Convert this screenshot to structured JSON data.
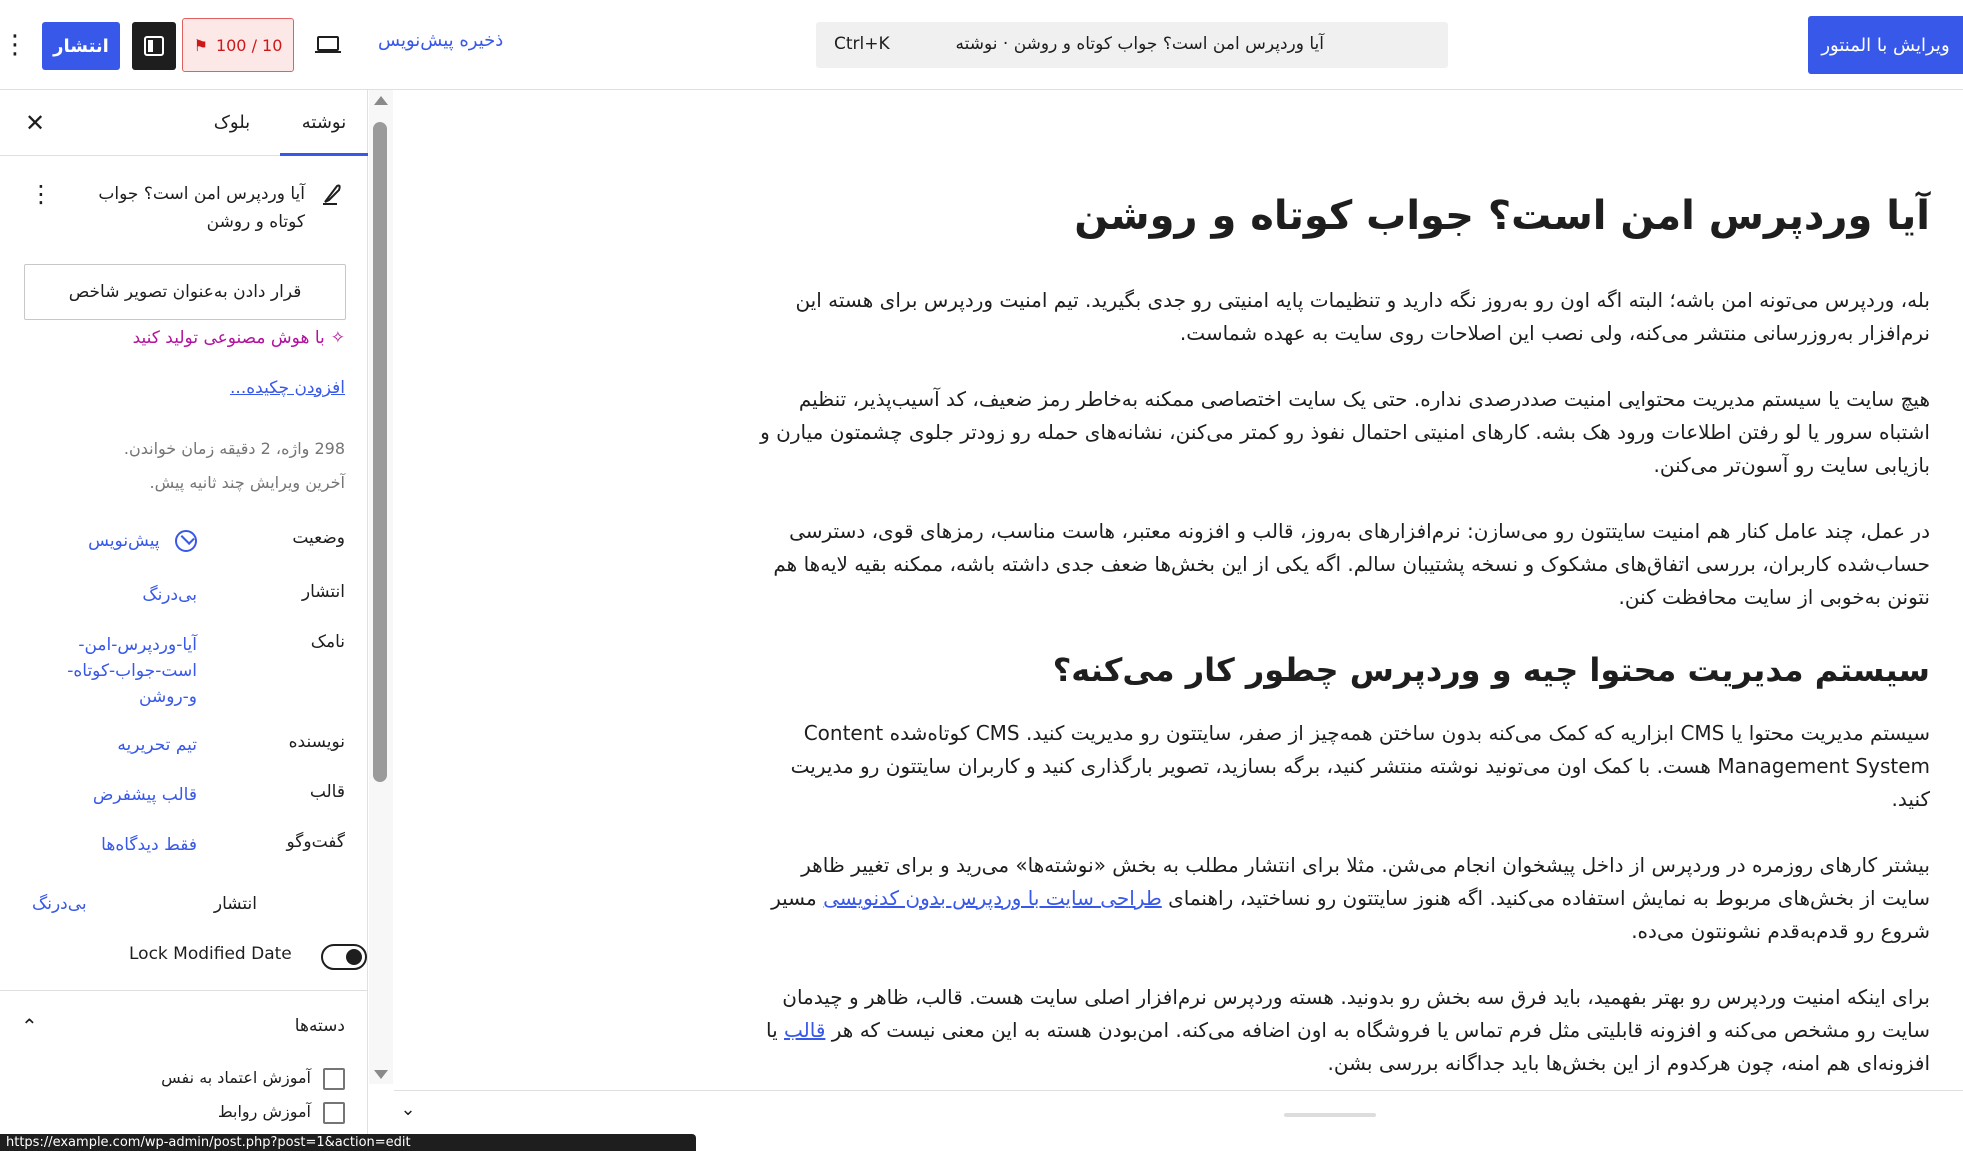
{
  "topbar": {
    "publish_label": "انتشار",
    "score": "100 / 10",
    "save_draft": "ذخیره پیش‌نویس",
    "command_shortcut": "Ctrl+K",
    "command_title": "آیا وردپرس امن است؟ جواب کوتاه و روشن · نوشته",
    "elementor_label": "ویرایش با المنتور"
  },
  "sidebar": {
    "tabs": {
      "post": "نوشته",
      "block": "بلوک"
    },
    "post_title": "آیا وردپرس امن است؟ جواب کوتاه و روشن",
    "featured_image": "قرار دادن به‌عنوان تصویر شاخص",
    "ai_generate": "با هوش مصنوعی تولید کنید",
    "add_excerpt": "افزودن چکیده...",
    "stats_words": "298 واژه، 2 دقیقه زمان خواندن.",
    "stats_edit": "آخرین ویرایش چند ثانیه پیش.",
    "rows": {
      "status": {
        "label": "وضعیت",
        "value": "پیش‌نویس"
      },
      "publish": {
        "label": "انتشار",
        "value": "بی‌درنگ"
      },
      "slug": {
        "label": "نامک",
        "value": "آیا-وردپرس-امن-است-جواب-کوتاه-و-روشن"
      },
      "author": {
        "label": "نویسنده",
        "value": "تیم تحریریه"
      },
      "template": {
        "label": "قالب",
        "value": "قالب پیشفرض"
      },
      "discussion": {
        "label": "گفت‌وگو",
        "value": "فقط دیدگاه‌ها"
      }
    },
    "publish2": {
      "label": "انتشار",
      "value": "بی‌درنگ"
    },
    "lock_modified": "Lock Modified Date",
    "categories": {
      "title": "دسته‌ها",
      "items": [
        "آموزش اعتماد به نفس",
        "آموزش روابط"
      ]
    }
  },
  "document": {
    "title": "آیا وردپرس امن است؟ جواب کوتاه و روشن",
    "p1": "بله، وردپرس می‌تونه امن باشه؛ البته اگه اون رو به‌روز نگه دارید و تنظیمات پایه امنیتی رو جدی بگیرید. تیم امنیت وردپرس برای هسته این نرم‌افزار به‌روزرسانی منتشر می‌کنه، ولی نصب این اصلاحات روی سایت به عهده شماست.",
    "p2": "هیچ سایت یا سیستم مدیریت محتوایی امنیت صددرصدی نداره. حتی یک سایت اختصاصی ممکنه به‌خاطر رمز ضعیف، کد آسیب‌پذیر، تنظیم اشتباه سرور یا لو رفتن اطلاعات ورود هک بشه. کارهای امنیتی احتمال نفوذ رو کمتر می‌کنن، نشانه‌های حمله رو زودتر جلوی چشمتون میارن و بازیابی سایت رو آسون‌تر می‌کنن.",
    "p3": "در عمل، چند عامل کنار هم امنیت سایتتون رو می‌سازن: نرم‌افزارهای به‌روز، قالب و افزونه معتبر، هاست مناسب، رمزهای قوی، دسترسی حساب‌شده کاربران، بررسی اتفاق‌های مشکوک و نسخه پشتیبان سالم. اگه یکی از این بخش‌ها ضعف جدی داشته باشه، ممکنه بقیه لایه‌ها هم نتونن به‌خوبی از سایت محافظت کنن.",
    "h2": "سیستم مدیریت محتوا چیه و وردپرس چطور کار می‌کنه؟",
    "p4": "سیستم مدیریت محتوا یا CMS ابزاریه که کمک می‌کنه بدون ساختن همه‌چیز از صفر، سایتتون رو مدیریت کنید. CMS کوتاه‌شده Content Management System هست. با کمک اون می‌تونید نوشته منتشر کنید، برگه بسازید، تصویر بارگذاری کنید و کاربران سایتتون رو مدیریت کنید.",
    "p5_a": "بیشتر کارهای روزمره در وردپرس از داخل پیشخوان انجام می‌شن. مثلا برای انتشار مطلب به بخش «نوشته‌ها» می‌رید و برای تغییر ظاهر سایت از بخش‌های مربوط به نمایش استفاده می‌کنید. اگه هنوز سایتتون رو نساختید، راهنمای ",
    "p5_link": "طراحی سایت با وردپرس بدون کدنویسی",
    "p5_b": " مسیر شروع رو قدم‌به‌قدم نشونتون می‌ده.",
    "p6_a": "برای اینکه امنیت وردپرس رو بهتر بفهمید، باید فرق سه بخش رو بدونید. هسته وردپرس نرم‌افزار اصلی سایت هست. قالب، ظاهر و چیدمان سایت رو مشخص می‌کنه و افزونه قابلیتی مثل فرم تماس یا فروشگاه به اون اضافه می‌کنه. امن‌بودن هسته به این معنی نیست که هر ",
    "p6_link": "قالب",
    "p6_b": " یا افزونه‌ای هم امنه، چون هرکدوم از این بخش‌ها باید جداگانه بررسی بشن."
  },
  "status_url": "https://example.com/wp-admin/post.php?post=1&action=edit",
  "colors": {
    "accent": "#3858e9",
    "score_bg": "#fde8e8",
    "score_text": "#cc1818",
    "ai": "#b3129c"
  }
}
